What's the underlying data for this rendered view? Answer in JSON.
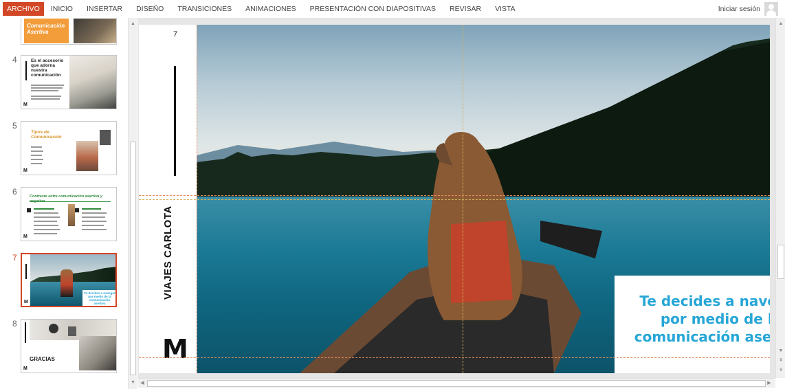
{
  "ribbon": {
    "tabs": [
      "ARCHIVO",
      "INICIO",
      "INSERTAR",
      "DISEÑO",
      "TRANSICIONES",
      "ANIMACIONES",
      "PRESENTACIÓN CON DIAPOSITIVAS",
      "REVISAR",
      "VISTA"
    ],
    "signin": "Iniciar sesión"
  },
  "thumbnails": {
    "slide3": {
      "title": "Comunicación Asertiva"
    },
    "slide4": {
      "number": "4",
      "title": "Es el accesorio que adorna nuestra comunicación"
    },
    "slide5": {
      "number": "5",
      "title": "Tipos de Comunicación"
    },
    "slide6": {
      "number": "6",
      "title": "Contraste entre comunicación asertiva y negativa"
    },
    "slide7": {
      "number": "7",
      "caption": "Te decides a navegar por medio de la comunicación asertiva"
    },
    "slide8": {
      "number": "8",
      "title": "GRACIAS"
    },
    "m_label": "M"
  },
  "slide": {
    "number": "7",
    "brand": "VIAJES CARLOTA",
    "logo": "M",
    "caption_line1": "Te decides a navegar",
    "caption_line2": "por medio de la",
    "caption_line3": "comunicación asertiva",
    "accent_color": "#26a6d6"
  },
  "colors": {
    "file_tab": "#d24726",
    "active_border": "#d24726"
  }
}
